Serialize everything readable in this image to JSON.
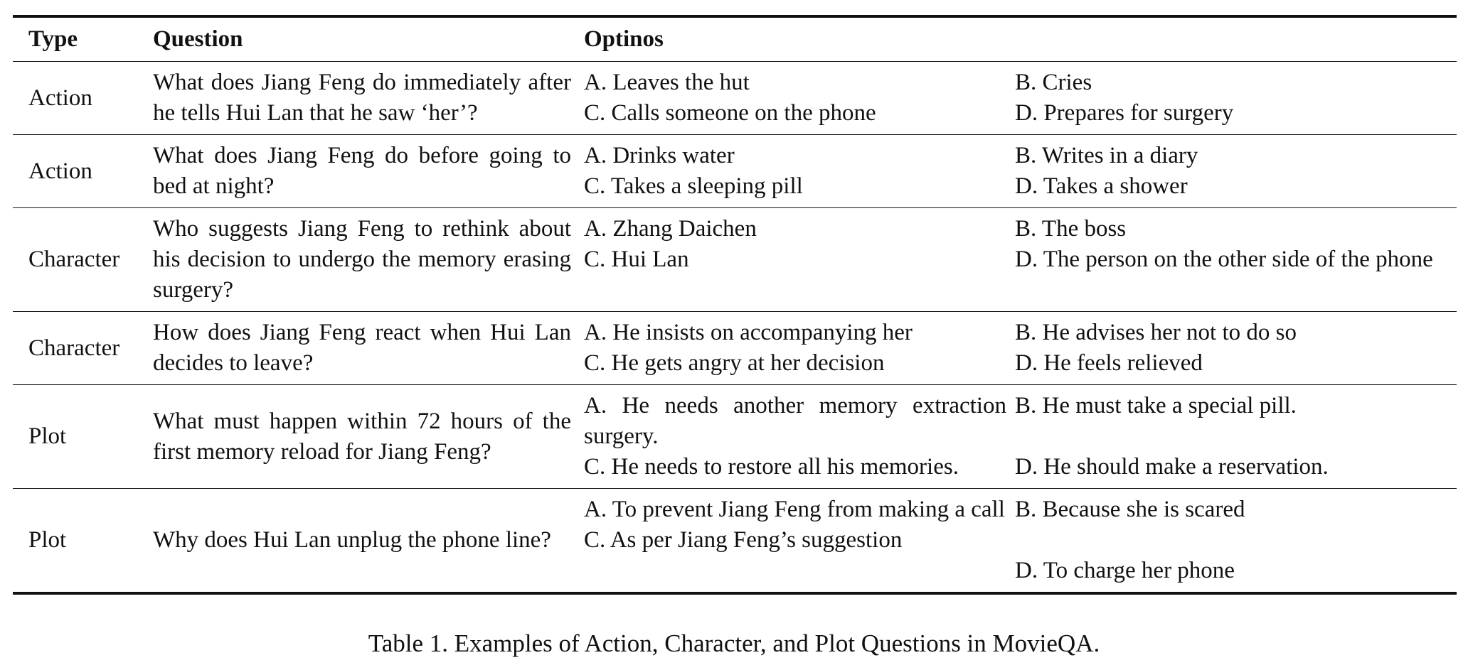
{
  "table": {
    "headers": {
      "type": "Type",
      "question": "Question",
      "options": "Optinos"
    },
    "rows": [
      {
        "type": "Action",
        "question": "What does Jiang Feng do immediately after he tells Hui Lan that he saw ‘her’?",
        "a": "A. Leaves the hut",
        "b": "B. Cries",
        "c": "C. Calls someone on the phone",
        "d": "D. Prepares for surgery"
      },
      {
        "type": "Action",
        "question": "What does Jiang Feng do before going to bed at night?",
        "a": "A. Drinks water",
        "b": "B. Writes in a diary",
        "c": "C. Takes a sleeping pill",
        "d": "D. Takes a shower"
      },
      {
        "type": "Character",
        "question": "Who suggests Jiang Feng to rethink about his decision to undergo the memory erasing surgery?",
        "a": "A. Zhang Daichen",
        "b": "B. The boss",
        "c": "C. Hui Lan",
        "d": "D. The person on the other side of the phone"
      },
      {
        "type": "Character",
        "question": "How does Jiang Feng react when Hui Lan decides to leave?",
        "a": "A. He insists on accompanying her",
        "b": "B. He advises her not to do so",
        "c": "C. He gets angry at her decision",
        "d": "D. He feels relieved"
      },
      {
        "type": "Plot",
        "question": "What must happen within 72 hours of the first memory reload for Jiang Feng?",
        "a": "A. He needs another memory extraction surgery.",
        "b": "B. He must take a special pill.",
        "c": "C. He needs to restore all his memories.",
        "d": "D. He should make a reservation."
      },
      {
        "type": "Plot",
        "question": "Why does Hui Lan unplug the phone line?",
        "a": "A. To prevent Jiang Feng from making a call",
        "b": "B. Because she is scared",
        "c": "C. As per Jiang Feng’s suggestion",
        "d": "D. To charge her phone"
      }
    ]
  },
  "caption": "Table 1. Examples of Action, Character, and Plot Questions in MovieQA."
}
